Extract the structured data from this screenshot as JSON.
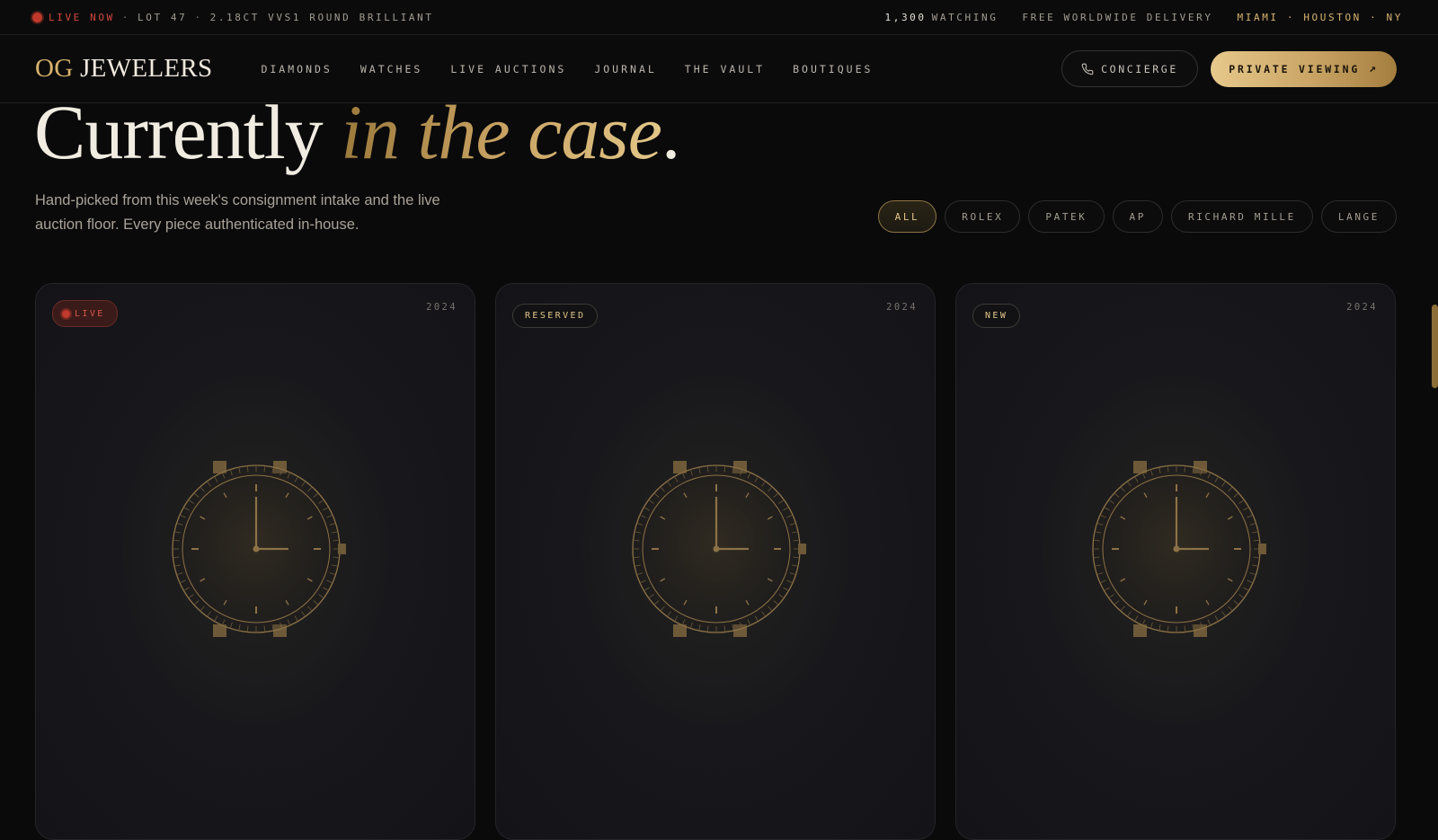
{
  "ticker": {
    "live_label": "LIVE NOW",
    "separator": "·",
    "lot_text": "LOT 47",
    "lot_desc": "2.18CT VVS1 ROUND BRILLIANT",
    "watch_count": "1,300",
    "watching_label": "WATCHING",
    "delivery": "FREE WORLDWIDE DELIVERY",
    "cities": "MIAMI · HOUSTON · NY"
  },
  "nav": {
    "logo_og": "OG",
    "logo_rest": "JEWELERS",
    "links": [
      "DIAMONDS",
      "WATCHES",
      "LIVE AUCTIONS",
      "JOURNAL",
      "THE VAULT",
      "BOUTIQUES"
    ],
    "concierge_label": "CONCIERGE",
    "private_label": "PRIVATE VIEWING",
    "private_arrow": "↗"
  },
  "hero": {
    "title_plain": "Currently",
    "title_italic": "in the case",
    "title_end": ".",
    "subcopy": "Hand-picked from this week's consignment intake and the live auction floor. Every piece authenticated in-house."
  },
  "filters": [
    "ALL",
    "ROLEX",
    "PATEK",
    "AP",
    "RICHARD MILLE",
    "LANGE"
  ],
  "active_filter": "ALL",
  "cards": [
    {
      "badge": "LIVE",
      "badge_type": "live",
      "year": "2024"
    },
    {
      "badge": "RESERVED",
      "badge_type": "reserved",
      "year": "2024"
    },
    {
      "badge": "NEW",
      "badge_type": "new",
      "year": "2024"
    }
  ],
  "colors": {
    "background": "#0a0a0b",
    "gold": "#d7b26a",
    "live_red": "#c0392b",
    "text": "#e9e4da"
  },
  "icons": {
    "concierge": "phone-icon",
    "card_image": "watch-icon",
    "live": "live-dot-icon"
  }
}
